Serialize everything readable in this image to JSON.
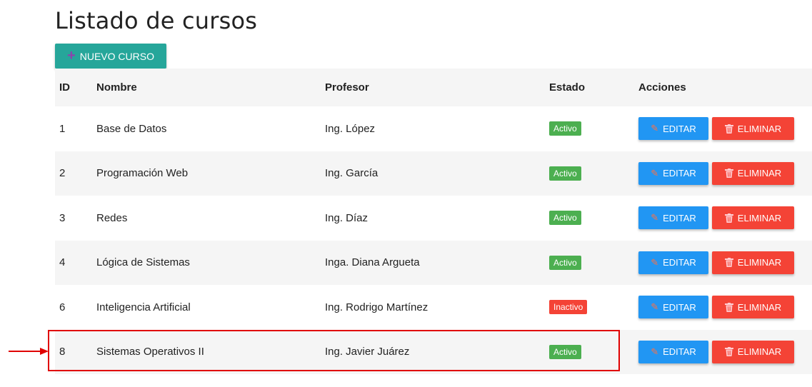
{
  "page": {
    "title": "Listado de cursos"
  },
  "toolbar": {
    "new_label": "NUEVO CURSO",
    "new_icon": "plus-icon"
  },
  "table": {
    "headers": {
      "id": "ID",
      "nombre": "Nombre",
      "profesor": "Profesor",
      "estado": "Estado",
      "acciones": "Acciones"
    },
    "rows": [
      {
        "id": "1",
        "nombre": "Base de Datos",
        "profesor": "Ing. López",
        "estado": "Activo",
        "edit": "EDITAR",
        "delete": "ELIMINAR"
      },
      {
        "id": "2",
        "nombre": "Programación Web",
        "profesor": "Ing. García",
        "estado": "Activo",
        "edit": "EDITAR",
        "delete": "ELIMINAR"
      },
      {
        "id": "3",
        "nombre": "Redes",
        "profesor": "Ing. Díaz",
        "estado": "Activo",
        "edit": "EDITAR",
        "delete": "ELIMINAR"
      },
      {
        "id": "4",
        "nombre": "Lógica de Sistemas",
        "profesor": "Inga. Diana Argueta",
        "estado": "Activo",
        "edit": "EDITAR",
        "delete": "ELIMINAR"
      },
      {
        "id": "6",
        "nombre": "Inteligencia Artificial",
        "profesor": "Ing. Rodrigo Martínez",
        "estado": "Inactivo",
        "edit": "EDITAR",
        "delete": "ELIMINAR"
      },
      {
        "id": "8",
        "nombre": "Sistemas Operativos II",
        "profesor": "Ing. Javier Juárez",
        "estado": "Activo",
        "edit": "EDITAR",
        "delete": "ELIMINAR"
      }
    ]
  },
  "colors": {
    "primary": "#26a69a",
    "edit": "#2196f3",
    "delete": "#f44336",
    "active": "#4caf50",
    "inactive": "#f44336",
    "annotation": "#e00000"
  },
  "icons": {
    "edit": "pencil-icon",
    "delete": "trash-icon"
  }
}
